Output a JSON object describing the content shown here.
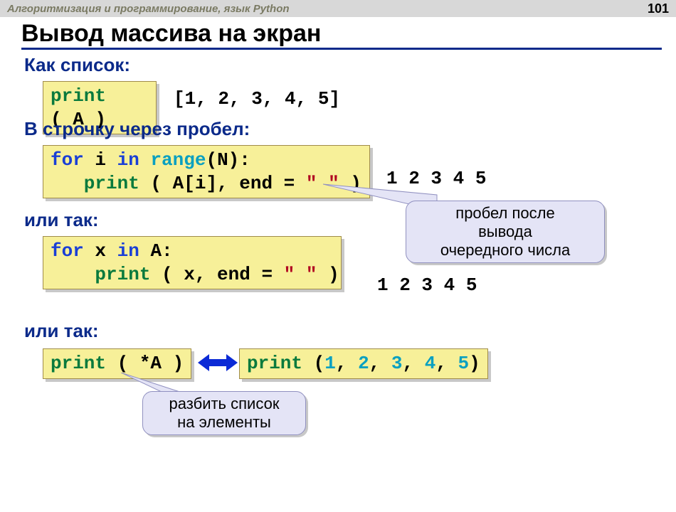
{
  "header": {
    "title": "Алгоритмизация и программирование, язык Python",
    "page": "101"
  },
  "slide_title": "Вывод массива на экран",
  "sections": {
    "as_list": "Как список:",
    "as_row": "В строчку через пробел:",
    "or1": "или так:",
    "or2": "или так:"
  },
  "code": {
    "print_A_1": "print",
    "print_A_2": "( A )",
    "loop1_l1a": "for",
    "loop1_l1b": " i ",
    "loop1_l1c": "in",
    "loop1_l1d": " range",
    "loop1_l1e": "(N):",
    "loop1_l2a": "   print",
    "loop1_l2b": " ( A[i], end",
    "loop1_l2c": " = ",
    "loop1_l2d": "\" \"",
    "loop1_l2e": " )",
    "loop2_l1a": "for",
    "loop2_l1b": " x ",
    "loop2_l1c": "in",
    "loop2_l1d": " A:",
    "loop2_l2a": "    print",
    "loop2_l2b": " ( x, end = ",
    "loop2_l2c": "\" \"",
    "loop2_l2d": " )",
    "starA_1": "print",
    "starA_2": " ( *A )",
    "expand_1": "print",
    "expand_2": " (",
    "expand_3": "1",
    "expand_c": ", ",
    "expand_4": "2",
    "expand_5": "3",
    "expand_6": "4",
    "expand_7": "5",
    "expand_8": ")"
  },
  "outputs": {
    "list": "[1, 2, 3, 4, 5]",
    "row1": "1 2 3 4 5",
    "row2": "1 2 3 4 5"
  },
  "callouts": {
    "bubble1_l1": "пробел после",
    "bubble1_l2": "вывода",
    "bubble1_l3": "очередного числа",
    "bubble2_l1": "разбить список",
    "bubble2_l2": "на элементы"
  }
}
